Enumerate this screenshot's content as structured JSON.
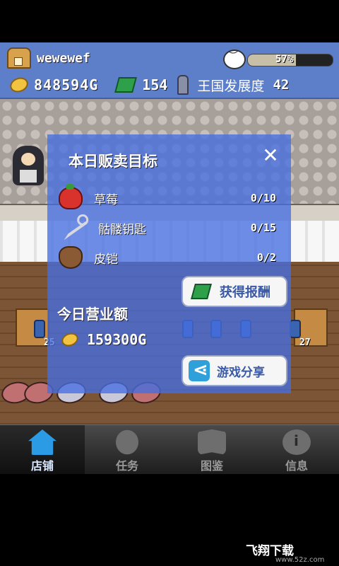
{
  "header": {
    "username": "wewewef",
    "progress_text": "57%",
    "progress_fraction": 0.57,
    "gold": "848594G",
    "gems": "154",
    "kingdom_label": "王国发展度",
    "kingdom_level": "42"
  },
  "shelves": {
    "left_count": "25",
    "right_count": "27"
  },
  "panel": {
    "title": "本日贩卖目标",
    "close_label": "✕",
    "targets": [
      {
        "icon": "strawberry-icon",
        "name": "草莓",
        "progress": "0/10"
      },
      {
        "icon": "skull-key-icon",
        "name": "骷髅钥匙",
        "progress": "0/15"
      },
      {
        "icon": "leather-armor-icon",
        "name": "皮铠",
        "progress": "0/2"
      }
    ],
    "reward_button": "获得报酬",
    "revenue_title": "今日营业额",
    "revenue_value": "159300G",
    "share_button": "游戏分享"
  },
  "tabs": [
    {
      "label": "店铺",
      "icon": "shop-icon",
      "active": true
    },
    {
      "label": "任务",
      "icon": "footprints-icon",
      "active": false
    },
    {
      "label": "图鉴",
      "icon": "book-icon",
      "active": false
    },
    {
      "label": "信息",
      "icon": "info-icon",
      "active": false
    }
  ],
  "watermark": {
    "text": "飞翔下载",
    "url": "www.52z.com"
  },
  "colors": {
    "header_blue": "#5d7ec9",
    "panel_blue": "#466ee0",
    "accent_tab": "#2b9be6"
  }
}
